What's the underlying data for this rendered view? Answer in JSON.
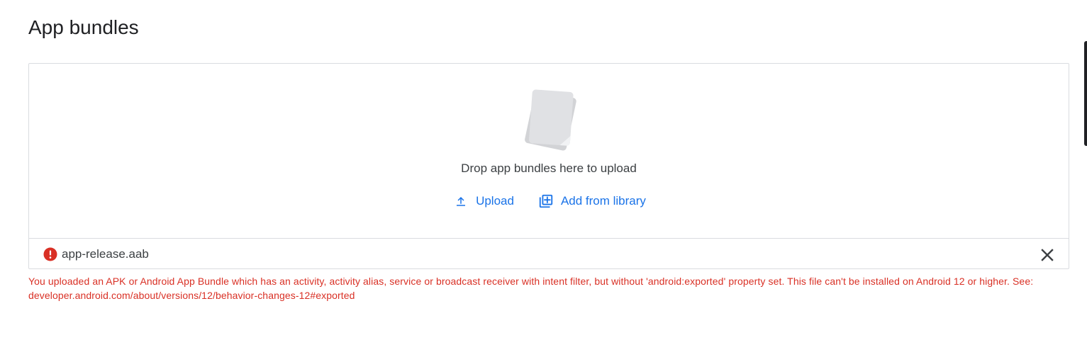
{
  "page": {
    "title": "App bundles"
  },
  "dropzone": {
    "illustration_icon": "file-stack-icon",
    "instruction": "Drop app bundles here to upload",
    "upload_label": "Upload",
    "upload_icon": "upload-icon",
    "library_label": "Add from library",
    "library_icon": "add-to-library-icon"
  },
  "file": {
    "name": "app-release.aab",
    "status_icon": "error-icon",
    "remove_icon": "close-icon"
  },
  "error": {
    "message": "You uploaded an APK or Android App Bundle which has an activity, activity alias, service or broadcast receiver with intent filter, but without 'android:exported' property set. This file can't be installed on Android 12 or higher. See: developer.android.com/about/versions/12/behavior-changes-12#exported"
  },
  "colors": {
    "accent": "#1a73e8",
    "error": "#d93025",
    "border": "#dadce0",
    "text": "#202124"
  }
}
